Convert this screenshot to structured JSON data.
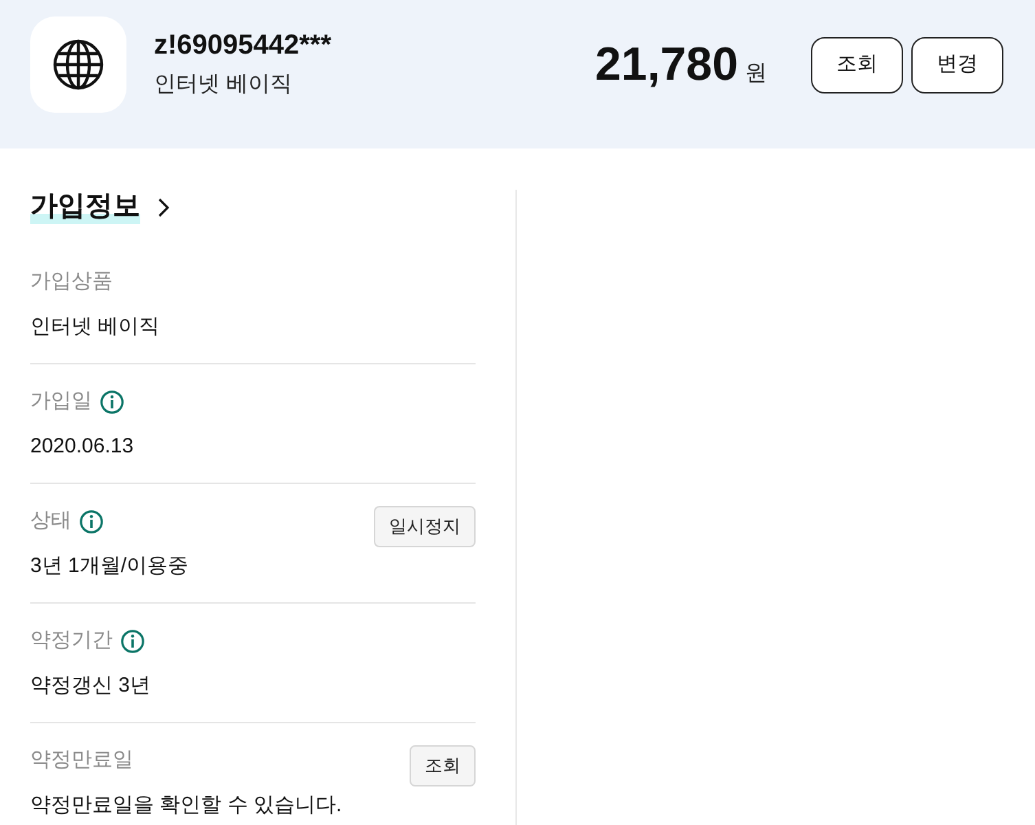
{
  "header": {
    "account_id": "z!69095442***",
    "product": "인터넷 베이직",
    "amount": "21,780",
    "currency": "원",
    "buttons": [
      "조회",
      "변경"
    ]
  },
  "section": {
    "title": "가입정보",
    "fields": [
      {
        "label": "가입상품",
        "value": "인터넷 베이직",
        "info": false
      },
      {
        "label": "가입일",
        "value": "2020.06.13",
        "info": true
      },
      {
        "label": "상태",
        "value": "3년 1개월/이용중",
        "info": true,
        "action": "일시정지"
      },
      {
        "label": "약정기간",
        "value": "약정갱신 3년",
        "info": true
      },
      {
        "label": "약정만료일",
        "value": "약정만료일을 확인할 수 있습니다.",
        "info": false,
        "action": "조회"
      }
    ]
  }
}
